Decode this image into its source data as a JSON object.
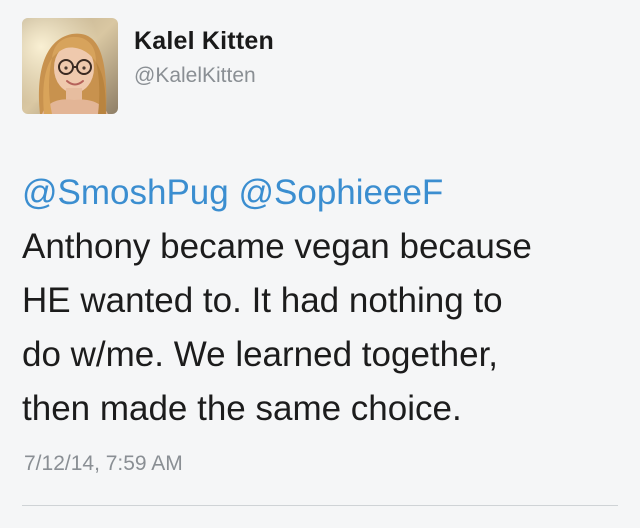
{
  "author": {
    "display_name": "Kalel Kitten",
    "handle": "@KalelKitten",
    "avatar_icon": "profile-photo-avatar"
  },
  "tweet": {
    "mentions": [
      "@SmoshPug",
      "@SophieeeF"
    ],
    "lines": [
      "Anthony became vegan because",
      "HE wanted to. It had nothing to",
      "do w/me. We learned together,",
      "then made the same choice."
    ],
    "timestamp": "7/12/14, 7:59 AM"
  },
  "colors": {
    "mention": "#3b8ed0",
    "background": "#f5f6f7",
    "meta_text": "#8a8f94"
  }
}
